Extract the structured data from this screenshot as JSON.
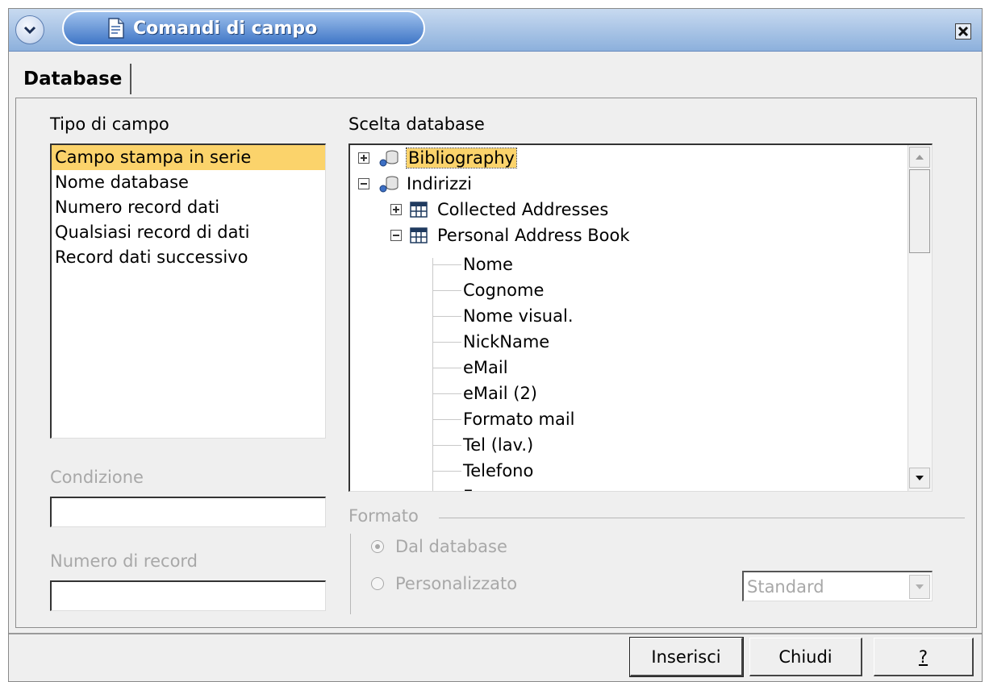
{
  "window": {
    "title": "Comandi di campo"
  },
  "tabs": [
    {
      "label": "Database"
    }
  ],
  "field_type": {
    "label": "Tipo di campo",
    "items": [
      {
        "label": "Campo stampa in serie",
        "selected": true
      },
      {
        "label": "Nome database"
      },
      {
        "label": "Numero record dati"
      },
      {
        "label": "Qualsiasi record di dati"
      },
      {
        "label": "Record dati successivo"
      }
    ]
  },
  "condition": {
    "label": "Condizione",
    "value": ""
  },
  "record_number": {
    "label": "Numero di record",
    "value": ""
  },
  "database_selection": {
    "label": "Scelta database",
    "tree": {
      "bibliography": "Bibliography",
      "indirizzi": "Indirizzi",
      "collected_addresses": "Collected Addresses",
      "personal_address_book": "Personal Address Book",
      "fields": [
        "Nome",
        "Cognome",
        "Nome visual.",
        "NickName",
        "eMail",
        "eMail (2)",
        "Formato mail",
        "Tel (lav.)",
        "Telefono",
        "F"
      ]
    }
  },
  "format": {
    "label": "Formato",
    "from_database": "Dal database",
    "custom": "Personalizzato",
    "select_value": "Standard"
  },
  "buttons": {
    "insert": "Inserisci",
    "close": "Chiudi",
    "help": "?"
  },
  "colors": {
    "selection": "#fbd36b",
    "title_blue": "#3f76c6",
    "disabled_text": "#a8a8a8"
  },
  "icons": {
    "menu": "chevron-down-icon",
    "document": "document-icon",
    "close": "close-icon",
    "database": "database-icon",
    "table": "table-icon"
  }
}
